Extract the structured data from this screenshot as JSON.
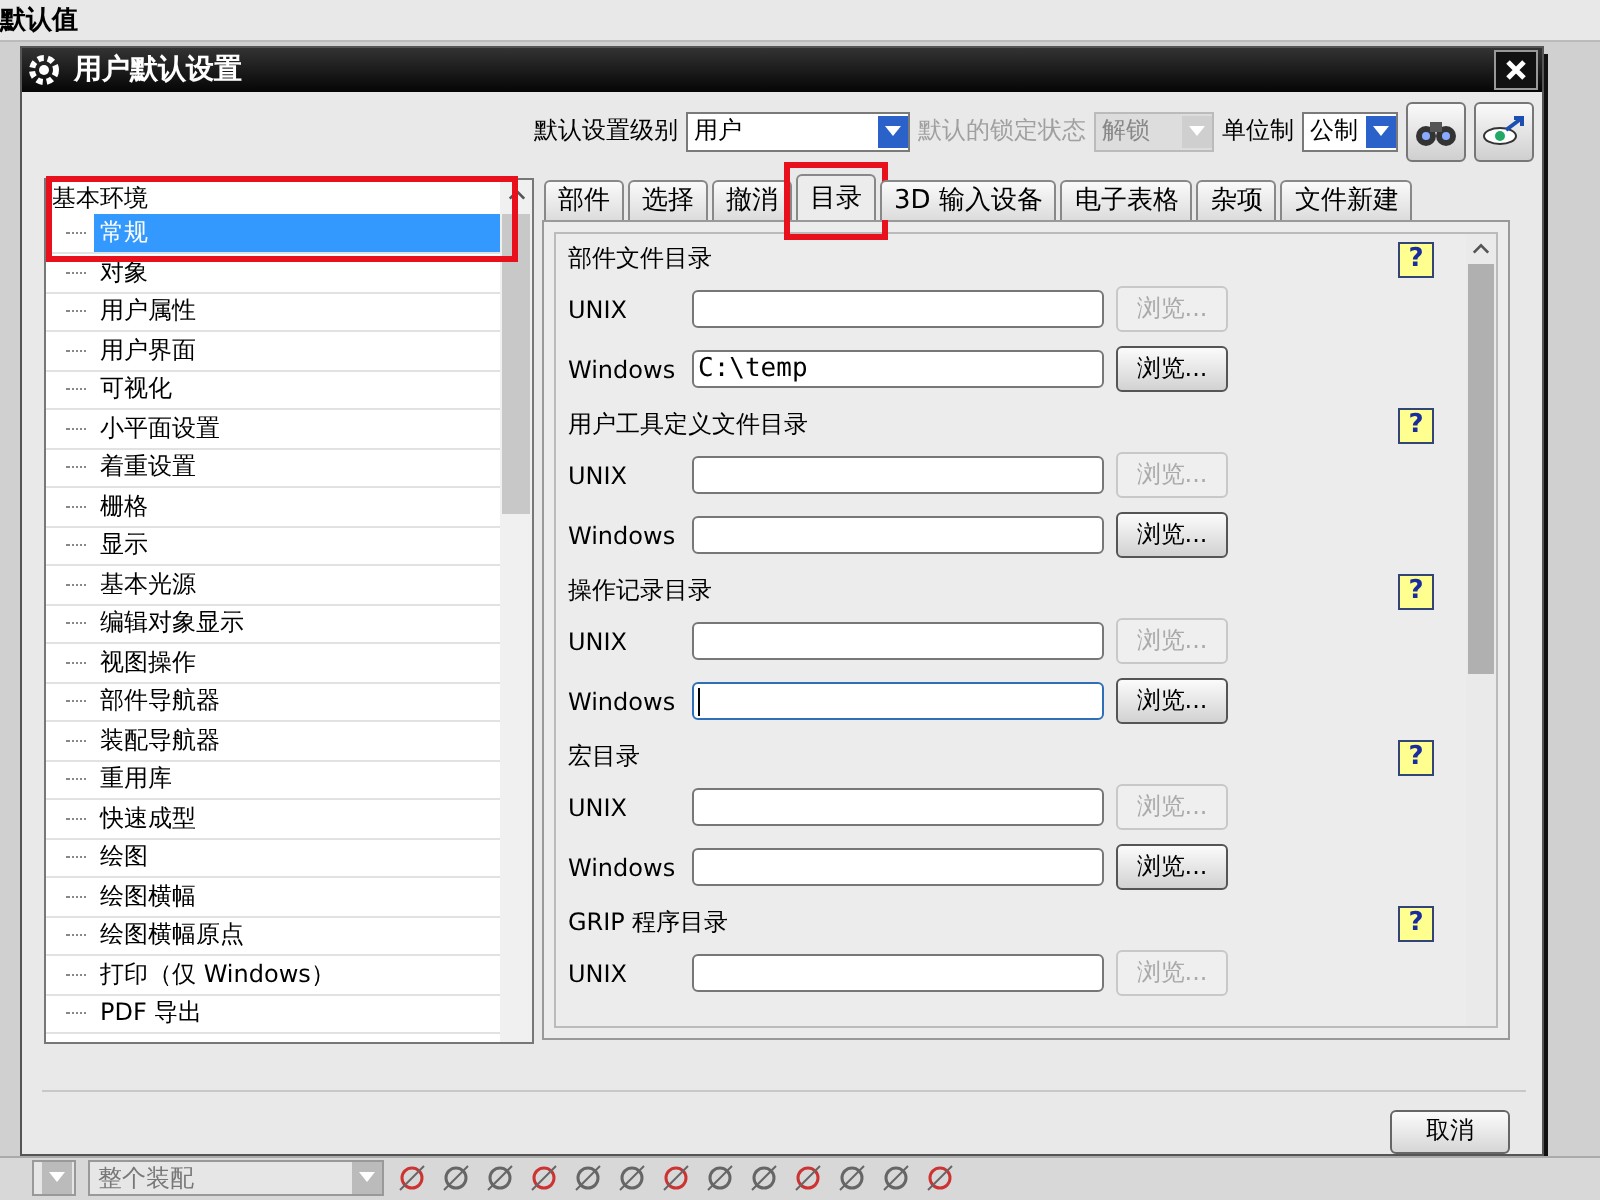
{
  "background": {
    "title": "默认值",
    "assembly_combo": "整个装配"
  },
  "window": {
    "title": "用户默认设置"
  },
  "toolbar": {
    "level_label": "默认设置级别",
    "level_value": "用户",
    "lock_label": "默认的锁定状态",
    "lock_value": "解锁",
    "lock_disabled": true,
    "units_label": "单位制",
    "units_value": "公制"
  },
  "tree": {
    "label": "基本环境",
    "highlighted": true,
    "children": [
      {
        "label": "常规",
        "selected": true
      },
      {
        "label": "对象",
        "selected": false
      },
      {
        "label": "用户属性",
        "selected": false
      },
      {
        "label": "用户界面",
        "selected": false
      },
      {
        "label": "可视化",
        "selected": false
      },
      {
        "label": "小平面设置",
        "selected": false
      },
      {
        "label": "着重设置",
        "selected": false
      },
      {
        "label": "栅格",
        "selected": false
      },
      {
        "label": "显示",
        "selected": false
      },
      {
        "label": "基本光源",
        "selected": false
      },
      {
        "label": "编辑对象显示",
        "selected": false
      },
      {
        "label": "视图操作",
        "selected": false
      },
      {
        "label": "部件导航器",
        "selected": false
      },
      {
        "label": "装配导航器",
        "selected": false
      },
      {
        "label": "重用库",
        "selected": false
      },
      {
        "label": "快速成型",
        "selected": false
      },
      {
        "label": "绘图",
        "selected": false
      },
      {
        "label": "绘图横幅",
        "selected": false
      },
      {
        "label": "绘图横幅原点",
        "selected": false
      },
      {
        "label": "打印（仅 Windows）",
        "selected": false
      },
      {
        "label": "PDF 导出",
        "selected": false
      }
    ]
  },
  "tabs": [
    {
      "label": "部件",
      "selected": false,
      "highlighted": false
    },
    {
      "label": "选择",
      "selected": false,
      "highlighted": false
    },
    {
      "label": "撤消",
      "selected": false,
      "highlighted": false
    },
    {
      "label": "目录",
      "selected": true,
      "highlighted": true
    },
    {
      "label": "3D 输入设备",
      "selected": false,
      "highlighted": false
    },
    {
      "label": "电子表格",
      "selected": false,
      "highlighted": false
    },
    {
      "label": "杂项",
      "selected": false,
      "highlighted": false
    },
    {
      "label": "文件新建",
      "selected": false,
      "highlighted": false
    }
  ],
  "sections": [
    {
      "title": "部件文件目录",
      "help": "?",
      "rows": [
        {
          "label": "UNIX",
          "value": "",
          "focused": false,
          "button": "浏览...",
          "disabled": true
        },
        {
          "label": "Windows",
          "value": "C:\\temp",
          "focused": false,
          "button": "浏览...",
          "disabled": false
        }
      ]
    },
    {
      "title": "用户工具定义文件目录",
      "help": "?",
      "rows": [
        {
          "label": "UNIX",
          "value": "",
          "focused": false,
          "button": "浏览...",
          "disabled": true
        },
        {
          "label": "Windows",
          "value": "",
          "focused": false,
          "button": "浏览...",
          "disabled": false
        }
      ]
    },
    {
      "title": "操作记录目录",
      "help": "?",
      "rows": [
        {
          "label": "UNIX",
          "value": "",
          "focused": false,
          "button": "浏览...",
          "disabled": true
        },
        {
          "label": "Windows",
          "value": "",
          "focused": true,
          "button": "浏览...",
          "disabled": false
        }
      ]
    },
    {
      "title": "宏目录",
      "help": "?",
      "rows": [
        {
          "label": "UNIX",
          "value": "",
          "focused": false,
          "button": "浏览...",
          "disabled": true
        },
        {
          "label": "Windows",
          "value": "",
          "focused": false,
          "button": "浏览...",
          "disabled": false
        }
      ]
    },
    {
      "title": "GRIP 程序目录",
      "help": "?",
      "rows": [
        {
          "label": "UNIX",
          "value": "",
          "focused": false,
          "button": "浏览...",
          "disabled": true
        }
      ]
    }
  ],
  "footer": {
    "cancel": "取消"
  }
}
